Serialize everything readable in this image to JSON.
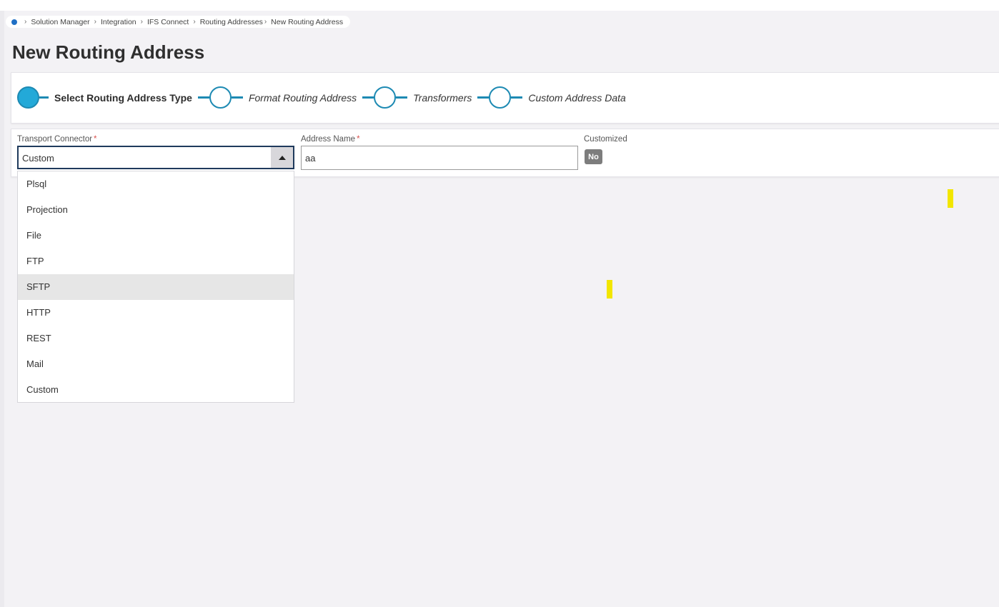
{
  "breadcrumb": {
    "items": [
      "Solution Manager",
      "Integration",
      "IFS Connect",
      "Routing Addresses",
      "New Routing Address"
    ]
  },
  "page": {
    "title": "New Routing Address"
  },
  "stepper": {
    "steps": [
      {
        "label": "Select Routing Address Type",
        "active": true
      },
      {
        "label": "Format Routing Address",
        "active": false
      },
      {
        "label": "Transformers",
        "active": false
      },
      {
        "label": "Custom Address Data",
        "active": false
      }
    ]
  },
  "form": {
    "transport_connector": {
      "label": "Transport Connector",
      "required_mark": "*",
      "value": "Custom"
    },
    "address_name": {
      "label": "Address Name",
      "required_mark": "*",
      "value": "aa"
    },
    "customized": {
      "label": "Customized",
      "value": "No"
    }
  },
  "dropdown": {
    "options": [
      "Plsql",
      "Projection",
      "File",
      "FTP",
      "SFTP",
      "HTTP",
      "REST",
      "Mail",
      "Custom"
    ],
    "hovered": "SFTP"
  },
  "colors": {
    "accent": "#1d8ab3",
    "active_step": "#23a9d8",
    "badge": "#7d7d7d",
    "marker": "#f2e600"
  }
}
